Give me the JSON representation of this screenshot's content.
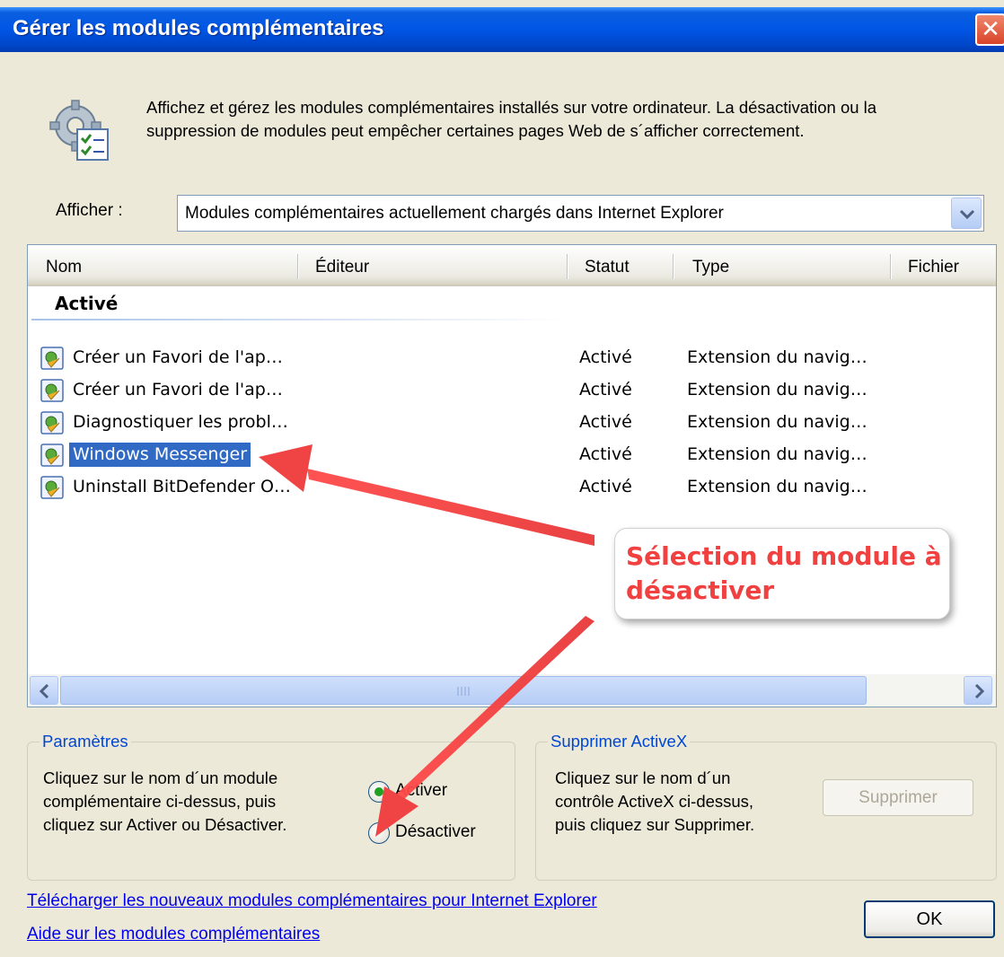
{
  "window": {
    "title": "Gérer les modules complémentaires",
    "close_label": "✕"
  },
  "header": {
    "description": "Affichez et gérez les modules complémentaires installés sur votre ordinateur. La désactivation ou la\nsuppression de modules peut empêcher certaines pages Web de s´afficher correctement."
  },
  "show": {
    "label": "Afficher :",
    "selected": "Modules complémentaires actuellement chargés dans Internet Explorer"
  },
  "list": {
    "columns": [
      "Nom",
      "Éditeur",
      "Statut",
      "Type",
      "Fichier"
    ],
    "group": "Activé",
    "rows": [
      {
        "name": "Créer un Favori de l'ap…",
        "status": "Activé",
        "type": "Extension du navig…"
      },
      {
        "name": "Créer un Favori de l'ap…",
        "status": "Activé",
        "type": "Extension du navig…"
      },
      {
        "name": "Diagnostiquer les probl…",
        "status": "Activé",
        "type": "Extension du navig…"
      },
      {
        "name": "Windows Messenger",
        "status": "Activé",
        "type": "Extension du navig…"
      },
      {
        "name": "Uninstall BitDefender O…",
        "status": "Activé",
        "type": "Extension du navig…"
      }
    ],
    "selected_index": 3
  },
  "settings": {
    "title": "Paramètres",
    "text": "Cliquez sur le nom d´un module\ncomplémentaire ci-dessus, puis\ncliquez sur Activer ou Désactiver.",
    "enable_label": "Activer",
    "disable_label": "Désactiver"
  },
  "activex": {
    "title": "Supprimer ActiveX",
    "text": "Cliquez sur le nom d´un\ncontrôle ActiveX ci-dessus,\npuis cliquez sur Supprimer.",
    "remove_label": "Supprimer"
  },
  "links": {
    "download": "Télécharger les nouveaux modules complémentaires pour Internet Explorer",
    "help": "Aide sur les modules complémentaires"
  },
  "ok_label": "OK",
  "annotation": {
    "text": "Sélection du module à\ndésactiver"
  },
  "colors": {
    "titlebar": "#0055e5",
    "selection": "#316ac5",
    "annotation": "#f04040",
    "groupbox_title": "#0046d5"
  }
}
